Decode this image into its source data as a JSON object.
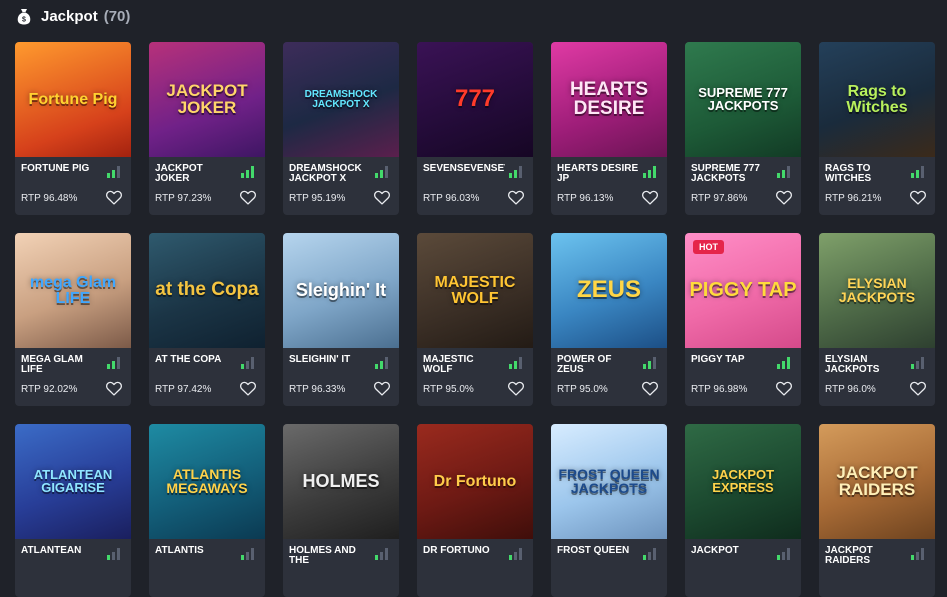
{
  "header": {
    "title": "Jackpot",
    "count": "(70)",
    "icon": "jackpot-bag-icon"
  },
  "colors": {
    "background": "#1f2229",
    "card": "#2d313b",
    "signal_on": "#43d96b",
    "signal_off": "#596070"
  },
  "games": [
    {
      "name": "FORTUNE PIG",
      "rtp": "RTP 96.48%",
      "signal": 2,
      "art": "Fortune Pig",
      "bg": "linear-gradient(160deg,#ff9a2e,#d6411b 70%,#a3220f)",
      "color": "#ffd230",
      "fs": 16
    },
    {
      "name": "JACKPOT JOKER",
      "rtp": "RTP 97.23%",
      "signal": 3,
      "art": "JACKPOT JOKER",
      "bg": "linear-gradient(160deg,#b7317a,#702188 60%,#3e1663)",
      "color": "#ffd56a",
      "fs": 17
    },
    {
      "name": "DREAMSHOCK JACKPOT X",
      "rtp": "RTP 95.19%",
      "signal": 2,
      "art": "DREAMSHOCK JACKPOT X",
      "bg": "linear-gradient(160deg,#3d2c5a,#1d2944 55%,#5b1f4d)",
      "color": "#63e8ff",
      "fs": 10
    },
    {
      "name": "SEVENSEVENSEVEN",
      "rtp": "RTP 96.03%",
      "signal": 2,
      "art": "777",
      "bg": "linear-gradient(160deg,#3a1255,#230b38 60%,#160624)",
      "color": "#ff3b2a",
      "fs": 24
    },
    {
      "name": "HEARTS DESIRE JP",
      "rtp": "RTP 96.13%",
      "signal": 3,
      "art": "HEARTS DESIRE",
      "bg": "linear-gradient(160deg,#e03aa4,#9d1d78 60%,#6b1454)",
      "color": "#ffe6f6",
      "fs": 19
    },
    {
      "name": "SUPREME 777 JACKPOTS",
      "rtp": "RTP 97.86%",
      "signal": 2,
      "art": "SUPREME 777 JACKPOTS",
      "bg": "linear-gradient(160deg,#2f7a4e,#1d5a37 60%,#123b25)",
      "color": "#ffffff",
      "fs": 13
    },
    {
      "name": "RAGS TO WITCHES",
      "rtp": "RTP 96.21%",
      "signal": 2,
      "art": "Rags to Witches",
      "bg": "linear-gradient(160deg,#24405a,#1a2b3c 55%,#3b2a1a)",
      "color": "#b8f05c",
      "fs": 16
    },
    {
      "name": "MEGA GLAM LIFE",
      "rtp": "RTP 92.02%",
      "signal": 2,
      "art": "mega Glam LIFE",
      "bg": "linear-gradient(160deg,#f2d2b6,#c9a081 55%,#7c5a48)",
      "color": "#3fa7ff",
      "fs": 16
    },
    {
      "name": "AT THE COPA",
      "rtp": "RTP 97.42%",
      "signal": 1,
      "art": "at the Copa",
      "bg": "linear-gradient(160deg,#2f5a6e,#1b3546 55%,#0f2130)",
      "color": "#f4c441",
      "fs": 19
    },
    {
      "name": "SLEIGHIN' IT",
      "rtp": "RTP 96.33%",
      "signal": 2,
      "art": "Sleighin' It",
      "bg": "linear-gradient(160deg,#b6d5ee,#7fa6c8 55%,#4b6f90)",
      "color": "#ffffff",
      "fs": 18
    },
    {
      "name": "MAJESTIC WOLF",
      "rtp": "RTP 95.0%",
      "signal": 2,
      "art": "MAJESTIC WOLF",
      "bg": "linear-gradient(160deg,#5b4a3a,#3a2e25 60%,#231b15)",
      "color": "#ffc533",
      "fs": 16
    },
    {
      "name": "POWER OF ZEUS",
      "rtp": "RTP 95.0%",
      "signal": 2,
      "art": "ZEUS",
      "bg": "linear-gradient(160deg,#6cc3ef,#3a86c2 55%,#1c4f86)",
      "color": "#ffd646",
      "fs": 24
    },
    {
      "name": "PIGGY TAP",
      "rtp": "RTP 96.98%",
      "signal": 3,
      "art": "PIGGY TAP",
      "bg": "linear-gradient(160deg,#ff8ec7,#f06aa8 55%,#d44a8a)",
      "color": "#ffdb3b",
      "fs": 20,
      "badge": "HOT"
    },
    {
      "name": "ELYSIAN JACKPOTS",
      "rtp": "RTP 96.0%",
      "signal": 1,
      "art": "ELYSIAN JACKPOTS",
      "bg": "linear-gradient(160deg,#7fa06a,#4f6b48 55%,#2e4030)",
      "color": "#ffd456",
      "fs": 14
    },
    {
      "name": "ATLANTEAN",
      "rtp": "",
      "signal": 1,
      "art": "ATLANTEAN GIGARISE",
      "bg": "linear-gradient(160deg,#3b6cc7,#283e98 55%,#1a1f5e)",
      "color": "#8fe6ff",
      "fs": 13
    },
    {
      "name": "ATLANTIS",
      "rtp": "",
      "signal": 1,
      "art": "ATLANTIS MEGAWAYS",
      "bg": "linear-gradient(160deg,#1e8ba3,#135f7a 55%,#0b3a52)",
      "color": "#ffd24a",
      "fs": 14
    },
    {
      "name": "HOLMES AND THE",
      "rtp": "",
      "signal": 1,
      "art": "HOLMES",
      "bg": "linear-gradient(160deg,#6a6a6a,#3d3d3d 55%,#1f1f1f)",
      "color": "#f0f0f0",
      "fs": 18
    },
    {
      "name": "DR FORTUNO",
      "rtp": "",
      "signal": 1,
      "art": "Dr Fortuno",
      "bg": "linear-gradient(160deg,#9a2a1e,#6e1a14 55%,#3f0e0a)",
      "color": "#ffcc4a",
      "fs": 16
    },
    {
      "name": "FROST QUEEN",
      "rtp": "",
      "signal": 1,
      "art": "FROST QUEEN JACKPOTS",
      "bg": "linear-gradient(160deg,#d7ecff,#9cc6ec 55%,#6d93bd)",
      "color": "#1c4a8c",
      "fs": 14
    },
    {
      "name": "JACKPOT",
      "rtp": "",
      "signal": 1,
      "art": "JACKPOT EXPRESS",
      "bg": "linear-gradient(160deg,#2f6a45,#1c4a30 55%,#0f2c1d)",
      "color": "#ffd24a",
      "fs": 13
    },
    {
      "name": "JACKPOT RAIDERS",
      "rtp": "",
      "signal": 1,
      "art": "JACKPOT RAIDERS",
      "bg": "linear-gradient(160deg,#d49b5b,#a86b36 55%,#6e431f)",
      "color": "#fff0b8",
      "fs": 17
    }
  ]
}
